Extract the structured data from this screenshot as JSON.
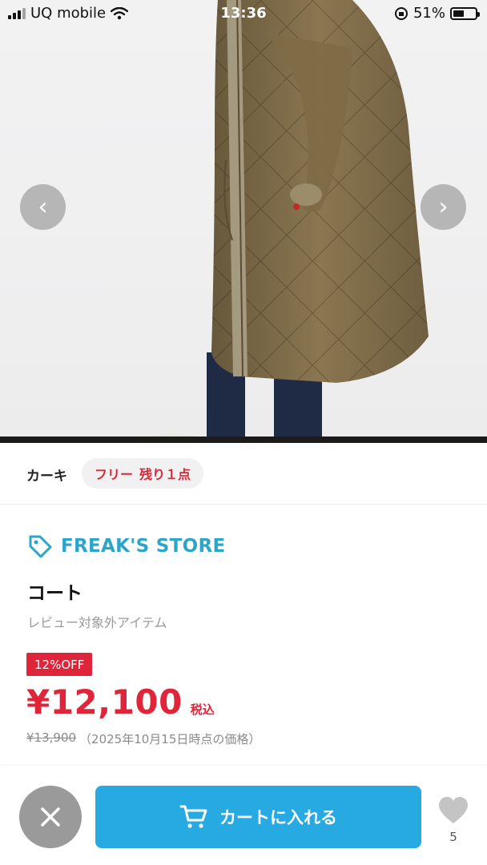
{
  "status_bar": {
    "carrier": "UQ mobile",
    "time": "13:36",
    "battery_percent": "51%",
    "battery_level": 0.51,
    "icons": [
      "signal-icon",
      "wifi-icon",
      "orientation-lock-icon",
      "battery-icon"
    ]
  },
  "gallery": {
    "prev_arrow": "‹",
    "next_arrow": "›"
  },
  "variant": {
    "color": "カーキ",
    "size": "フリー",
    "stock": "残り１点"
  },
  "product": {
    "brand": "FREAK'S STORE",
    "title": "コート",
    "review_note": "レビュー対象外アイテム",
    "discount_badge": "12%OFF",
    "price": "¥12,100",
    "tax_label": "税込",
    "original_price": "¥13,900",
    "original_price_note": "（2025年10月15日時点の価格）"
  },
  "bottom_bar": {
    "add_to_cart_label": "カートに入れる",
    "favorite_count": "5"
  },
  "colors": {
    "accent_blue": "#27a9e1",
    "brand_teal": "#2aa6c9",
    "price_red": "#e0243a",
    "close_gray": "#9a9a9a"
  }
}
